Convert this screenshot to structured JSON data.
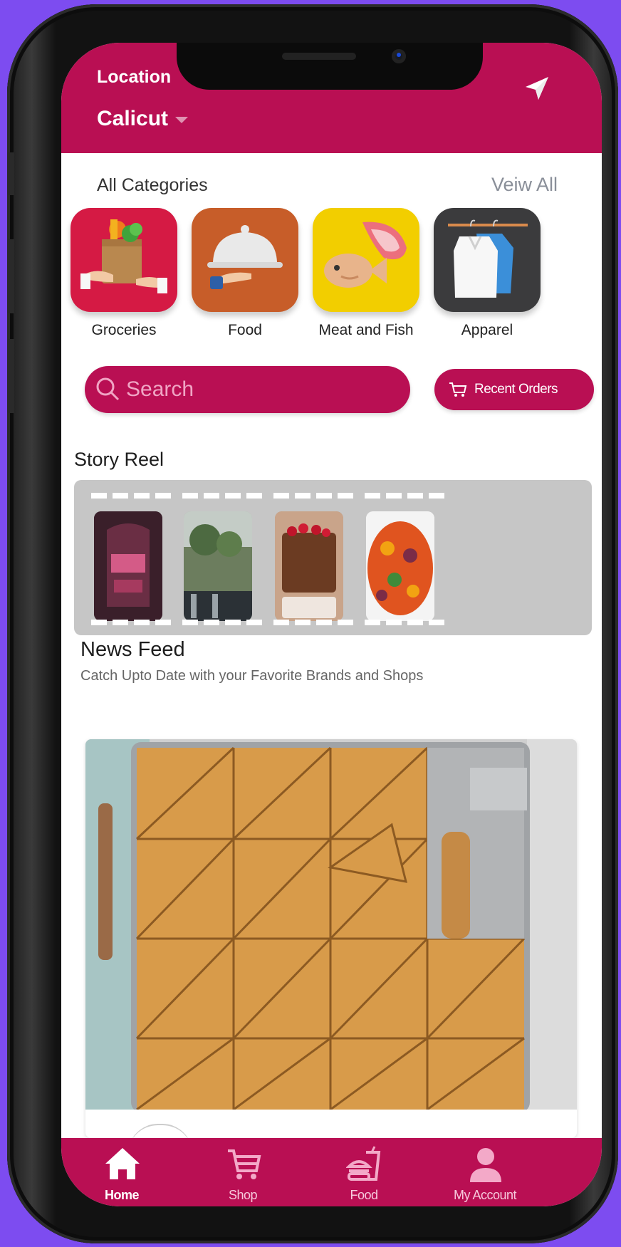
{
  "header": {
    "location_label": "Location",
    "city": "Calicut",
    "send_icon": "send-location-icon"
  },
  "categories": {
    "title": "All Categories",
    "view_all": "Veiw All",
    "items": [
      {
        "label": "Groceries",
        "icon": "groceries-icon",
        "color": "#d51a44"
      },
      {
        "label": "Food",
        "icon": "food-cloche-icon",
        "color": "#c75d29"
      },
      {
        "label": "Meat and Fish",
        "icon": "meat-fish-icon",
        "color": "#f2ce00"
      },
      {
        "label": "Apparel",
        "icon": "apparel-icon",
        "color": "#3b3b3d"
      }
    ]
  },
  "search": {
    "placeholder": "Search"
  },
  "recent_orders": {
    "label": "Recent Orders"
  },
  "story_reel": {
    "title": "Story Reel",
    "stories": [
      {
        "name": "story-poster"
      },
      {
        "name": "story-trees"
      },
      {
        "name": "story-cake"
      },
      {
        "name": "story-salad"
      }
    ]
  },
  "news_feed": {
    "title": "News Feed",
    "subtitle": "Catch Upto Date with your Favorite Brands and Shops"
  },
  "bottom_nav": {
    "items": [
      {
        "label": "Home",
        "icon": "home-icon",
        "active": true
      },
      {
        "label": "Shop",
        "icon": "cart-icon",
        "active": false
      },
      {
        "label": "Food",
        "icon": "burger-drink-icon",
        "active": false
      },
      {
        "label": "My Account",
        "icon": "user-icon",
        "active": false
      }
    ]
  },
  "colors": {
    "brand": "#b90f53",
    "background": "#7d4cf0",
    "reel_bg": "#c6c6c6"
  }
}
